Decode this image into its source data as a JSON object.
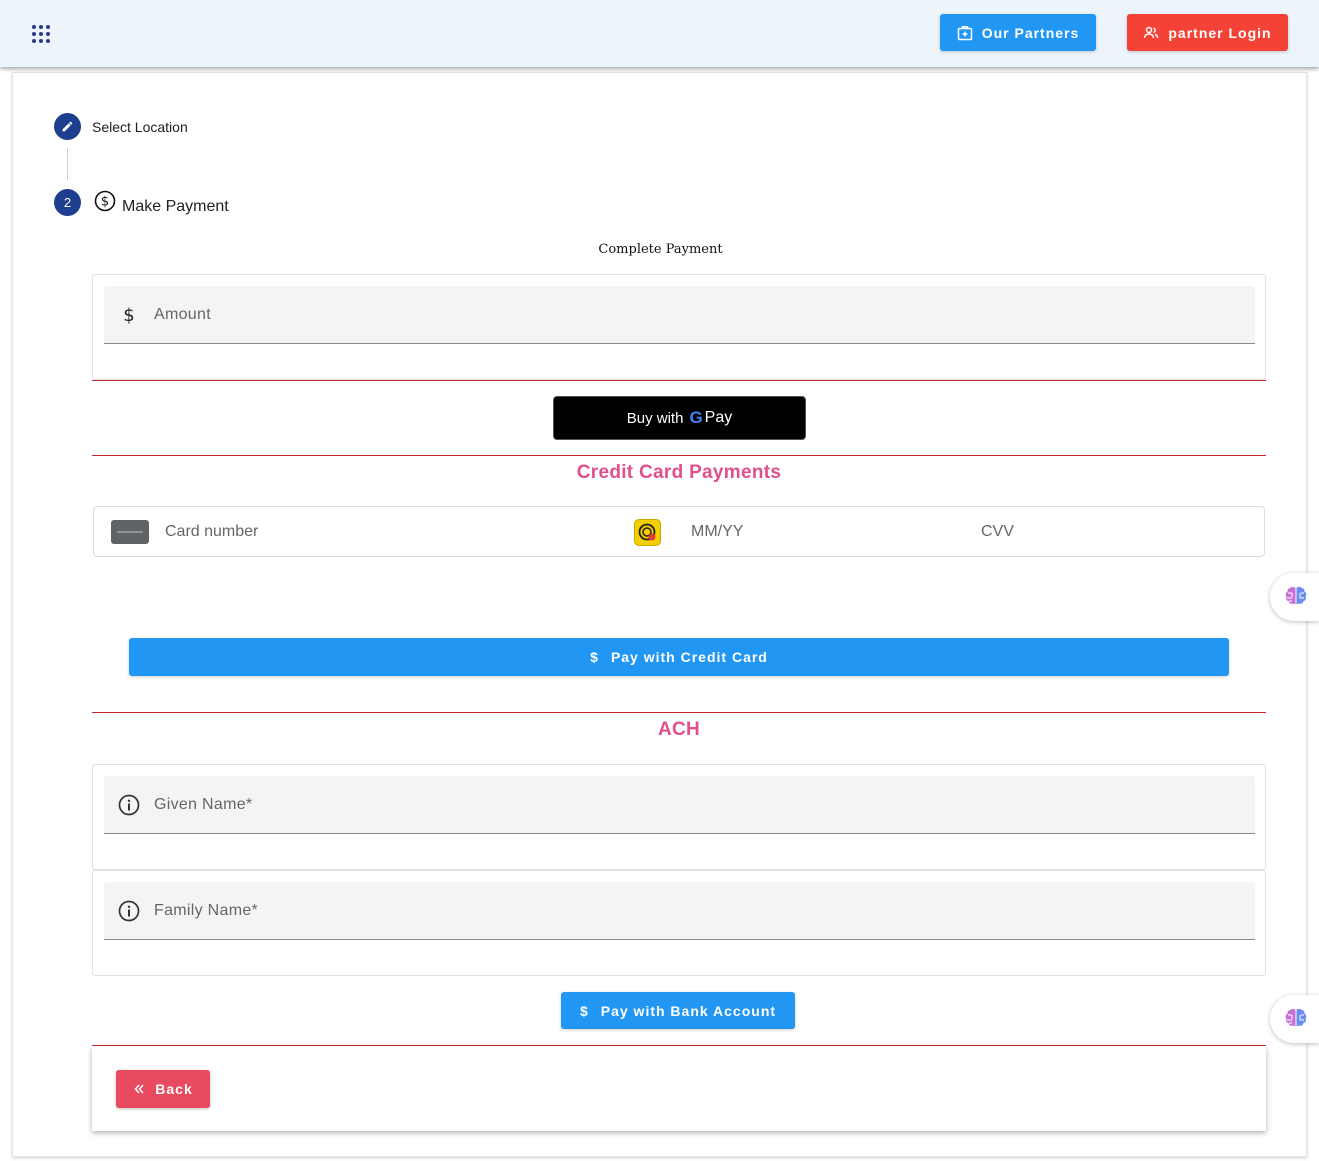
{
  "header": {
    "partners_label": "Our Partners",
    "login_label": "partner Login"
  },
  "stepper": {
    "step1_label": "Select Location",
    "step2_number": "2",
    "step2_label": "Make Payment"
  },
  "payment": {
    "title": "Complete Payment",
    "amount_placeholder": "Amount",
    "gpay_prefix": "Buy with",
    "gpay_g": "G",
    "gpay_pay": "Pay"
  },
  "credit_card": {
    "title": "Credit Card Payments",
    "card_number_placeholder": "Card number",
    "expiry_placeholder": "MM/YY",
    "cvv_placeholder": "CVV",
    "pay_label": "Pay with Credit Card",
    "currency_symbol": "$"
  },
  "ach": {
    "title": "ACH",
    "given_name_placeholder": "Given Name*",
    "family_name_placeholder": "Family Name*",
    "pay_label": "Pay with Bank Account",
    "currency_symbol": "$"
  },
  "footer": {
    "back_label": "Back"
  },
  "colors": {
    "primary": "#2196f3",
    "danger": "#f44336",
    "back": "#e84a5f",
    "step": "#1e3f8f",
    "section_title": "#e0508a",
    "divider": "#c62828"
  }
}
